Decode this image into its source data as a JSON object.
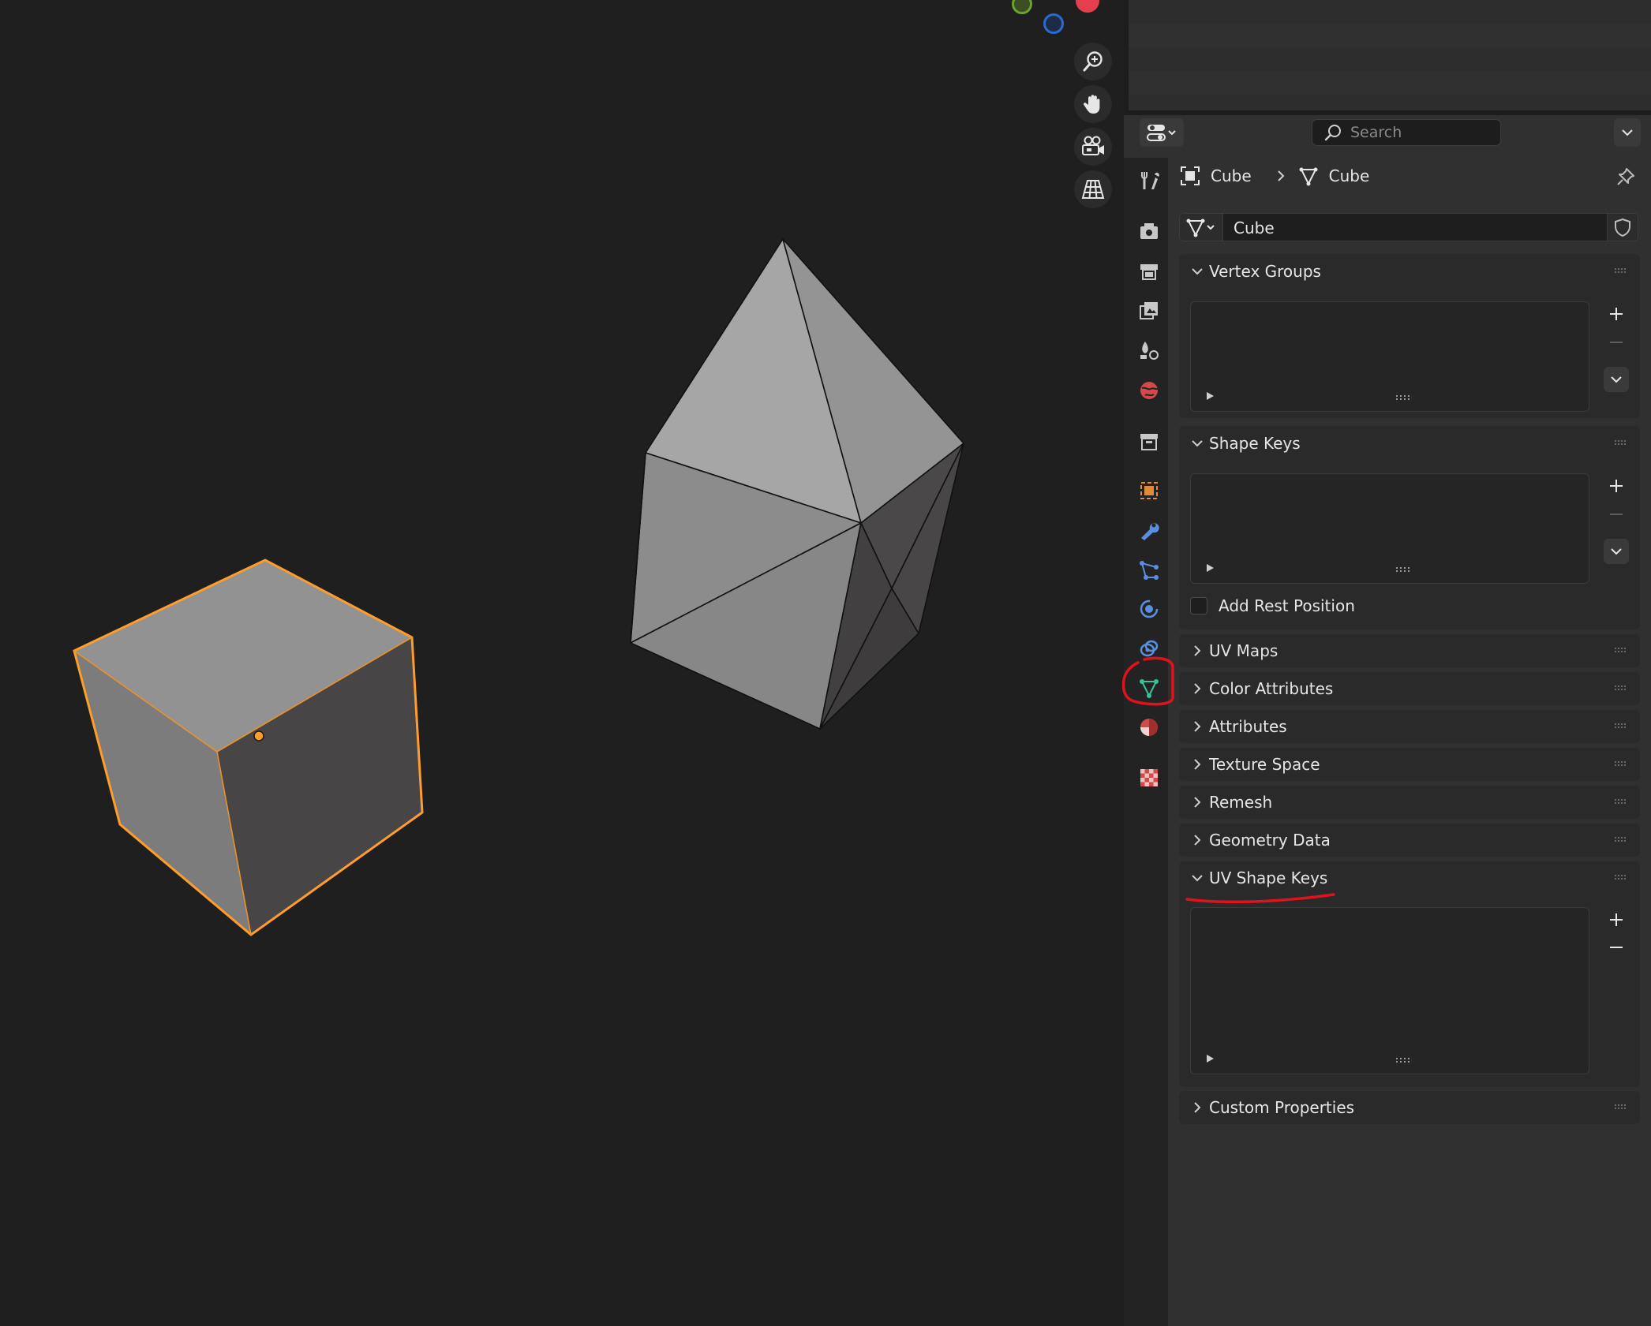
{
  "viewport": {
    "nav_buttons": [
      {
        "name": "zoom-icon"
      },
      {
        "name": "hand-pan-icon"
      },
      {
        "name": "camera-view-icon"
      },
      {
        "name": "perspective-grid-icon"
      }
    ],
    "gizmo": {
      "y_color": "#6ba32c",
      "z_color": "#2b6ad4",
      "x_color": "#e43f4f"
    },
    "selection_color": "#ff9d2a"
  },
  "header": {
    "search_placeholder": "Search"
  },
  "breadcrumb": {
    "object": "Cube",
    "mesh": "Cube"
  },
  "datablock": {
    "name": "Cube"
  },
  "tabs": [
    {
      "name": "tool-tab-icon",
      "color": "#c8c8c8"
    },
    {
      "name": "render-tab-icon",
      "color": "#c8c8c8"
    },
    {
      "name": "output-tab-icon",
      "color": "#c8c8c8"
    },
    {
      "name": "view-layer-tab-icon",
      "color": "#c8c8c8"
    },
    {
      "name": "scene-tab-icon",
      "color": "#c8c8c8"
    },
    {
      "name": "world-tab-icon",
      "color": "#d24a4a"
    },
    {
      "name": "collection-tab-icon",
      "color": "#c8c8c8"
    },
    {
      "name": "object-tab-icon",
      "color": "#e08a3c"
    },
    {
      "name": "modifier-tab-icon",
      "color": "#5a8fe0"
    },
    {
      "name": "particles-tab-icon",
      "color": "#5a8fe0"
    },
    {
      "name": "physics-tab-icon",
      "color": "#5a8fe0"
    },
    {
      "name": "constraints-tab-icon",
      "color": "#5a8fe0"
    },
    {
      "name": "mesh-data-tab-icon",
      "color": "#35c49a",
      "active": true
    },
    {
      "name": "material-tab-icon",
      "color": "#d24a4a"
    },
    {
      "name": "texture-tab-icon",
      "color": "#d24a4a"
    }
  ],
  "panels": {
    "vertex_groups": "Vertex Groups",
    "shape_keys": "Shape Keys",
    "add_rest_position": "Add Rest Position",
    "uv_maps": "UV Maps",
    "color_attributes": "Color Attributes",
    "attributes": "Attributes",
    "texture_space": "Texture Space",
    "remesh": "Remesh",
    "geometry_data": "Geometry Data",
    "uv_shape_keys": "UV Shape Keys",
    "custom_properties": "Custom Properties"
  },
  "annotation_color": "#e0121b"
}
